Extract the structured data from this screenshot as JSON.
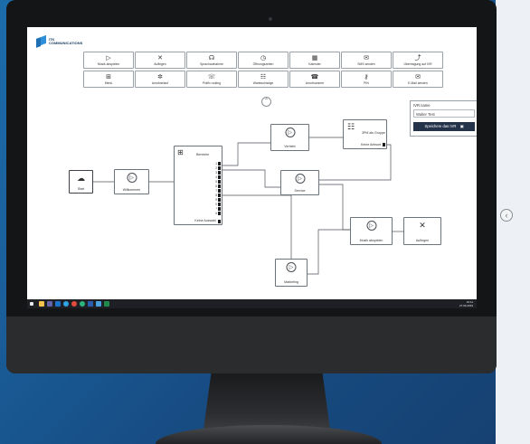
{
  "header": {
    "brand": "ITK\nCOMMUNICATIONS"
  },
  "toolbar": [
    {
      "label": "Musik abspielen",
      "icon": "play-icon",
      "glyph": "▷"
    },
    {
      "label": "Auflegen",
      "icon": "hangup-icon",
      "glyph": "✕"
    },
    {
      "label": "Sprachaufnahme",
      "icon": "voice-record-icon",
      "glyph": "☊"
    },
    {
      "label": "Öffnungszeiten",
      "icon": "clock-icon",
      "glyph": "◷"
    },
    {
      "label": "Kalender",
      "icon": "calendar-icon",
      "glyph": "▦"
    },
    {
      "label": "SMS senden",
      "icon": "sms-icon",
      "glyph": "✉"
    },
    {
      "label": "Übertragung auf IVR",
      "icon": "transfer-icon",
      "glyph": "⤴"
    },
    {
      "label": "Menü",
      "icon": "menu-tree-icon",
      "glyph": "⊞"
    },
    {
      "label": "Anrufverlauf",
      "icon": "call-history-icon",
      "glyph": "✲"
    },
    {
      "label": "Präfix routing",
      "icon": "prefix-routing-icon",
      "glyph": "☏"
    },
    {
      "label": "Warteschlange",
      "icon": "queue-icon",
      "glyph": "☷"
    },
    {
      "label": "Anrufnummer",
      "icon": "call-number-icon",
      "glyph": "☎"
    },
    {
      "label": "PIN",
      "icon": "pin-key-icon",
      "glyph": "⚷"
    },
    {
      "label": "E-Mail senden",
      "icon": "email-icon",
      "glyph": "✉"
    }
  ],
  "collapse_glyph": "⌃",
  "ivr_panel": {
    "label": "IVR name",
    "value": "Walter Test",
    "save_label": "Speichere das IVR",
    "save_glyph": "▣"
  },
  "nodes": {
    "start": {
      "label": "Start",
      "glyph": "☁"
    },
    "willkommen": {
      "label": "Willkommen",
      "glyph": "▷"
    },
    "bereiche": {
      "title": "Bereiche",
      "glyph": "⊞",
      "options": [
        "1",
        "2",
        "3",
        "4",
        "5",
        "6",
        "7",
        "8",
        "9",
        "0",
        "*",
        "#"
      ],
      "fallback": "Keine Auswahl"
    },
    "vertrieb": {
      "label": "Vertrieb",
      "glyph": "▷"
    },
    "service": {
      "label": "Service",
      "glyph": "▷"
    },
    "marketing": {
      "label": "Marketing",
      "glyph": "▷"
    },
    "group": {
      "title": "3PM als Gruppe",
      "subtitle": "Keine Antwort",
      "glyph": "☷"
    },
    "musik": {
      "label": "Musik abspielen",
      "glyph": "▷"
    },
    "auflegen": {
      "label": "Auflegen",
      "glyph": "✕"
    }
  },
  "taskbar": {
    "time": "10:11",
    "date": "27.06.2019"
  },
  "sidebar": {
    "expand_glyph": "‹"
  },
  "colors": {
    "accent": "#24324a",
    "background": "#1b5c99",
    "taskbar": "#1e2026"
  }
}
